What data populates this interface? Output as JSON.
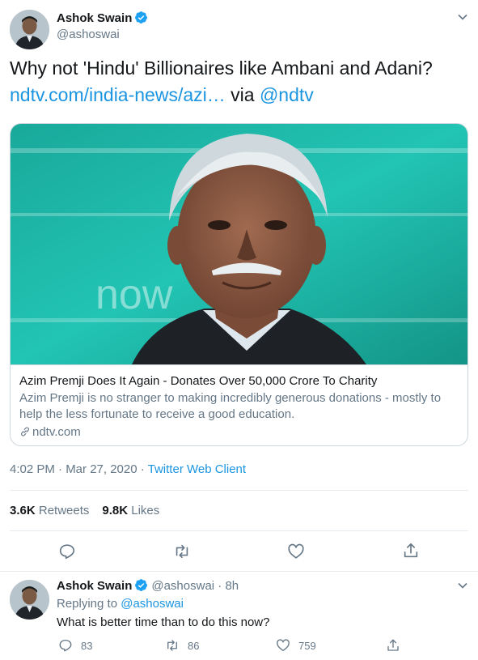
{
  "tweet": {
    "author_name": "Ashok Swain",
    "author_handle": "@ashoswai",
    "text_before": "Why not 'Hindu' Billionaires like Ambani and Adani?",
    "link_text": "ndtv.com/india-news/azi…",
    "via_text": " via ",
    "via_handle": "@ndtv",
    "timestamp": "4:02 PM · Mar 27, 2020 · ",
    "client": "Twitter Web Client",
    "retweets_count": "3.6K",
    "retweets_label": "Retweets",
    "likes_count": "9.8K",
    "likes_label": "Likes"
  },
  "card": {
    "title": "Azim Premji Does It Again - Donates Over 50,000 Crore To Charity",
    "description": "Azim Premji is no stranger to making incredibly generous donations - mostly to help the less fortunate to receive a good education.",
    "domain": "ndtv.com"
  },
  "reply": {
    "author_name": "Ashok Swain",
    "author_handle": "@ashoswai",
    "time": "8h",
    "separator": " · ",
    "replying_label": "Replying to ",
    "replying_handle": "@ashoswai",
    "text": "What is better time than to do this now?",
    "reply_count": "83",
    "retweet_count": "86",
    "like_count": "759"
  },
  "colors": {
    "link": "#1b95e0",
    "secondary_text": "#657786",
    "border": "#ccd6dd",
    "card_background": "#1fb7a8"
  },
  "icons": [
    "verified-badge-icon",
    "chevron-down-icon",
    "reply-icon",
    "retweet-icon",
    "like-icon",
    "share-icon",
    "link-icon"
  ]
}
